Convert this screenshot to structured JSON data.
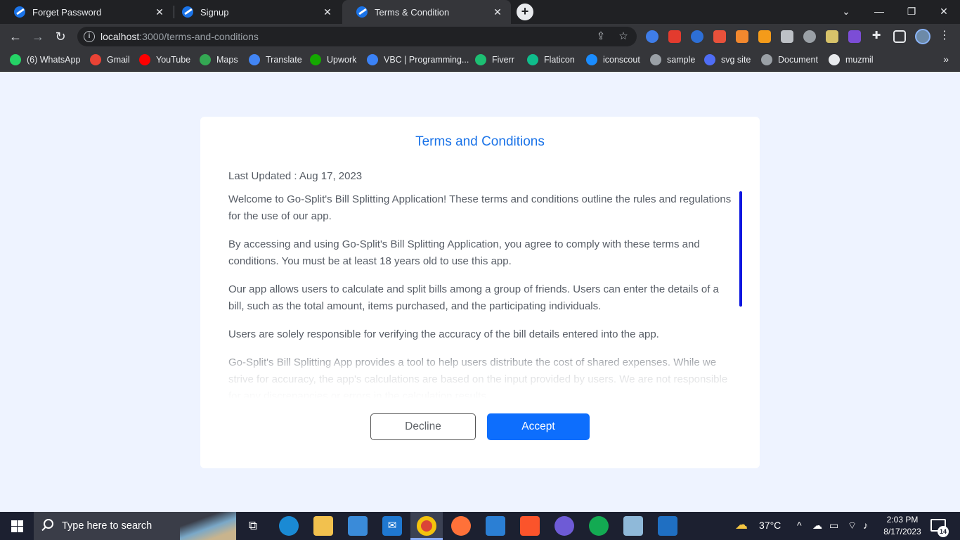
{
  "browser": {
    "tabs": [
      {
        "title": "Forget Password"
      },
      {
        "title": "Signup"
      },
      {
        "title": "Terms & Condition"
      }
    ],
    "url_host": "localhost",
    "url_path": ":3000/terms-and-conditions",
    "bookmarks": [
      {
        "label": "(6) WhatsApp",
        "color": "#25d366"
      },
      {
        "label": "Gmail",
        "color": "#ea4335"
      },
      {
        "label": "YouTube",
        "color": "#ff0000"
      },
      {
        "label": "Maps",
        "color": "#34a853"
      },
      {
        "label": "Translate",
        "color": "#4285f4"
      },
      {
        "label": "Upwork",
        "color": "#14a800"
      },
      {
        "label": "VBC | Programming...",
        "color": "#3b82f6"
      },
      {
        "label": "Fiverr",
        "color": "#1dbf73"
      },
      {
        "label": "Flaticon",
        "color": "#0fbd8c"
      },
      {
        "label": "iconscout",
        "color": "#1a8cff"
      },
      {
        "label": "sample",
        "color": "#9aa0a6"
      },
      {
        "label": "svg site",
        "color": "#4f6df5"
      },
      {
        "label": "Document",
        "color": "#9aa0a6"
      },
      {
        "label": "muzmil",
        "color": "#e8eaed"
      }
    ]
  },
  "terms": {
    "title": "Terms and Conditions",
    "last_updated": "Last Updated : Aug 17, 2023",
    "paragraphs": [
      "Welcome to Go-Split's Bill Splitting Application! These terms and conditions outline the rules and regulations for the use of our app.",
      "By accessing and using Go-Split's Bill Splitting Application, you agree to comply with these terms and conditions. You must be at least 18 years old to use this app.",
      "Our app allows users to calculate and split bills among a group of friends. Users can enter the details of a bill, such as the total amount, items purchased, and the participating individuals.",
      "Users are solely responsible for verifying the accuracy of the bill details entered into the app.",
      "Go-Split's Bill Splitting App provides a tool to help users distribute the cost of shared expenses. While we strive for accuracy, the app's calculations are based on the input provided by users. We are not responsible for any discrepancies or errors in the calculation results."
    ],
    "decline_label": "Decline",
    "accept_label": "Accept"
  },
  "taskbar": {
    "search_placeholder": "Type here to search",
    "temperature": "37°C",
    "time": "2:03 PM",
    "date": "8/17/2023",
    "notification_count": "14"
  }
}
